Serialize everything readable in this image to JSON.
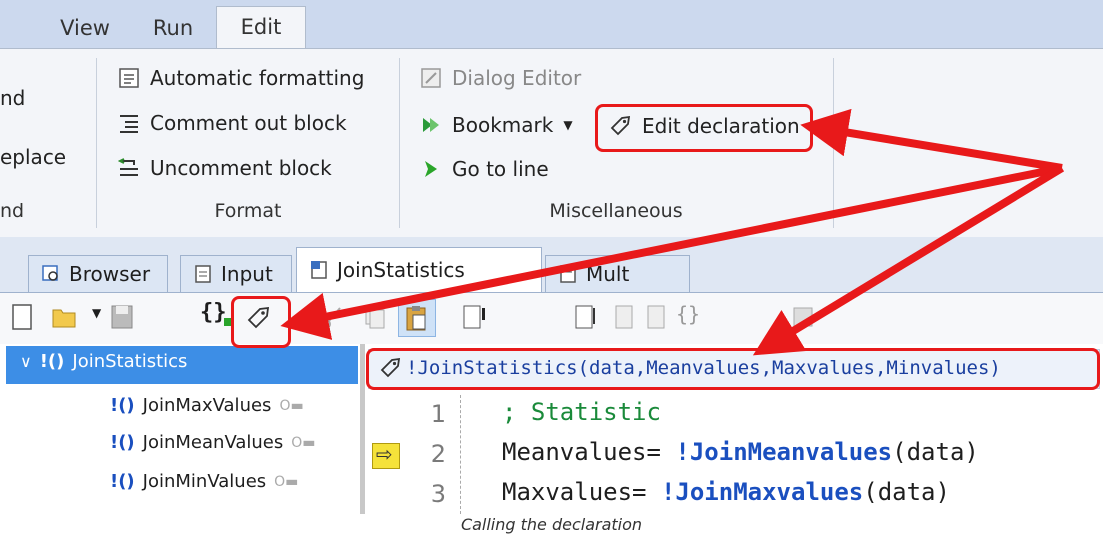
{
  "ribbon_tabs": [
    "View",
    "Run",
    "Edit"
  ],
  "ribbon": {
    "find_group": {
      "items": [
        "nd",
        "eplace"
      ],
      "label": "nd"
    },
    "format_group": {
      "items": [
        "Automatic formatting",
        "Comment out block",
        "Uncomment block"
      ],
      "label": "Format"
    },
    "misc_group": {
      "dialog_editor": "Dialog Editor",
      "bookmark": "Bookmark",
      "go_to_line": "Go to line",
      "edit_declaration": "Edit declaration",
      "label": "Miscellaneous"
    }
  },
  "editor_tabs": [
    "Browser",
    "Input",
    "JoinStatistics",
    "Mult"
  ],
  "tree": {
    "root": "JoinStatistics",
    "root_prefix": "!()",
    "children": [
      "JoinMaxValues",
      "JoinMeanValues",
      "JoinMinValues"
    ],
    "child_prefix": "!()"
  },
  "declaration": "!JoinStatistics(data,Meanvalues,Maxvalues,Minvalues)",
  "code": {
    "line_numbers": [
      "1",
      "2",
      "3"
    ],
    "lines": [
      {
        "text": "; Statistic"
      },
      {
        "pre": "Meanvalues= ",
        "call": "!JoinMeanvalues",
        "post": "(data)"
      },
      {
        "pre": "Maxvalues= ",
        "call": "!JoinMaxvalues",
        "post": "(data)"
      }
    ]
  },
  "caption": "Calling the declaration",
  "colors": {
    "annotation": "#e8191a",
    "ribbon_tabbar": "#ccd9ee",
    "tree_selection": "#3d8ee6",
    "comment": "#1a8a3a",
    "call": "#1a4fbf"
  }
}
